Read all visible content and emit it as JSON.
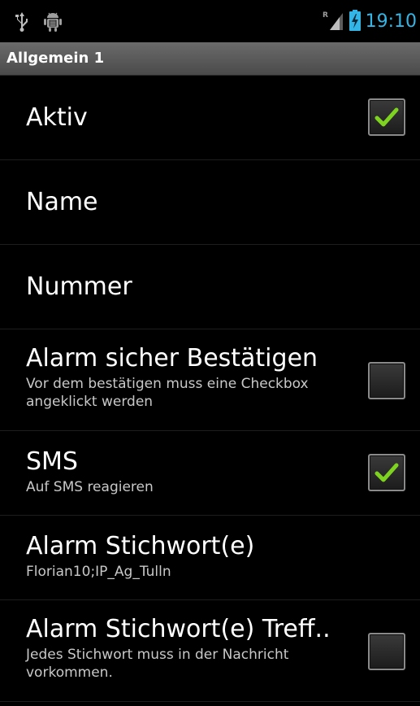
{
  "status_bar": {
    "time": "19:10",
    "time_color": "#33b5e5",
    "icons": [
      "usb-icon",
      "android-debug-icon",
      "signal-roaming-icon",
      "battery-charging-icon"
    ]
  },
  "title_bar": {
    "title": "Allgemein 1"
  },
  "preferences": [
    {
      "title": "Aktiv",
      "summary": "",
      "checkbox": true,
      "checked": true
    },
    {
      "title": "Name",
      "summary": "",
      "checkbox": false
    },
    {
      "title": "Nummer",
      "summary": "",
      "checkbox": false
    },
    {
      "title": "Alarm sicher Bestätigen",
      "summary": "Vor dem bestätigen muss eine Checkbox angeklickt werden",
      "checkbox": true,
      "checked": false
    },
    {
      "title": "SMS",
      "summary": "Auf SMS reagieren",
      "checkbox": true,
      "checked": true
    },
    {
      "title": "Alarm Stichwort(e)",
      "summary": "Florian10;IP_Ag_Tulln",
      "checkbox": false
    },
    {
      "title": "Alarm Stichwort(e) Treff..",
      "summary": "Jedes Stichwort muss in der Nachricht vorkommen.",
      "checkbox": true,
      "checked": false
    }
  ],
  "colors": {
    "check_mark": "#7ed321",
    "background": "#000000",
    "titlebar": "#555555"
  }
}
